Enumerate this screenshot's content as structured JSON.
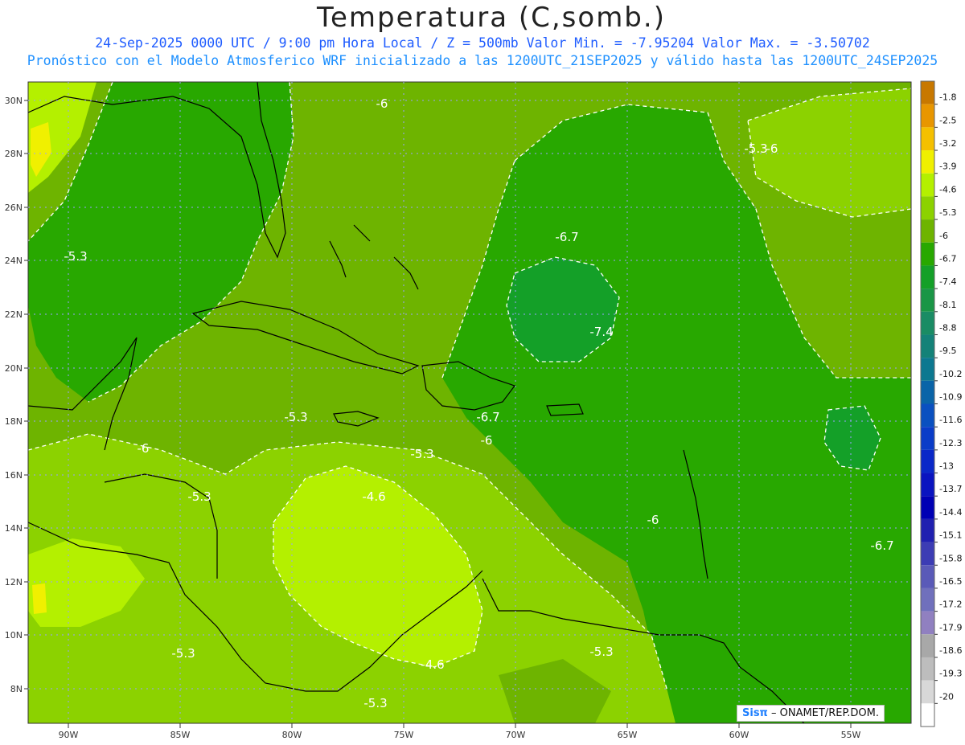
{
  "title": "Temperatura (C,somb.)",
  "subtitle_line1": "24-Sep-2025  0000 UTC / 9:00 pm Hora Local / Z = 500mb  Valor Min. = -7.95204  Valor Max. = -3.50702",
  "subtitle_line2": "Pronóstico con el Modelo Atmosferico WRF inicializado a las 1200UTC_21SEP2025 y válido hasta las  1200UTC_24SEP2025",
  "credit": {
    "logo": "Sisπ",
    "text": "– ONAMET/REP.DOM."
  },
  "lat_labels": [
    "30N",
    "28N",
    "26N",
    "24N",
    "22N",
    "20N",
    "18N",
    "16N",
    "14N",
    "12N",
    "10N",
    "8N"
  ],
  "lon_labels": [
    "90W",
    "85W",
    "80W",
    "75W",
    "70W",
    "65W",
    "60W",
    "55W"
  ],
  "colorbar": [
    {
      "label": "-1.8",
      "color": "#c87800"
    },
    {
      "label": "-2.5",
      "color": "#e89600"
    },
    {
      "label": "-3.2",
      "color": "#f5c000"
    },
    {
      "label": "-3.9",
      "color": "#f0f000"
    },
    {
      "label": "-4.6",
      "color": "#b4f000"
    },
    {
      "label": "-5.3",
      "color": "#8cd200"
    },
    {
      "label": "-6",
      "color": "#6eb400"
    },
    {
      "label": "-6.7",
      "color": "#28a800"
    },
    {
      "label": "-7.4",
      "color": "#14a028"
    },
    {
      "label": "-8.1",
      "color": "#1a9646"
    },
    {
      "label": "-8.8",
      "color": "#1a8c64"
    },
    {
      "label": "-9.5",
      "color": "#148278"
    },
    {
      "label": "-10.2",
      "color": "#0c7890"
    },
    {
      "label": "-10.9",
      "color": "#0a64a8"
    },
    {
      "label": "-11.6",
      "color": "#0a50c0"
    },
    {
      "label": "-12.3",
      "color": "#0a3cc8"
    },
    {
      "label": "-13",
      "color": "#0a28c8"
    },
    {
      "label": "-13.7",
      "color": "#0a14c0"
    },
    {
      "label": "-14.4",
      "color": "#0000b4"
    },
    {
      "label": "-15.1",
      "color": "#2020b0"
    },
    {
      "label": "-15.8",
      "color": "#3c3cb4"
    },
    {
      "label": "-16.5",
      "color": "#5a5ab8"
    },
    {
      "label": "-17.2",
      "color": "#7070bc"
    },
    {
      "label": "-17.9",
      "color": "#9080c0"
    },
    {
      "label": "-18.6",
      "color": "#a8a8a8"
    },
    {
      "label": "-19.3",
      "color": "#bdbdbd"
    },
    {
      "label": "-20",
      "color": "#d8d8d8"
    },
    {
      "label": "",
      "color": "#ffffff"
    }
  ],
  "contour_labels": [
    "-6",
    "-5.3",
    "-6.7",
    "-6",
    "-7.4",
    "-5.3",
    "-6.7",
    "-6",
    "-6",
    "-5.3",
    "-5.3",
    "-4.6",
    "-5.3",
    "-6",
    "-6.7",
    "-5.3",
    "-4.6",
    "-5.3",
    "-5.3"
  ],
  "region_colors": {
    "c46": "#b4f000",
    "c53": "#8cd200",
    "c60": "#6eb400",
    "c67": "#28a800",
    "c74": "#14a028",
    "c39": "#f0f000"
  }
}
